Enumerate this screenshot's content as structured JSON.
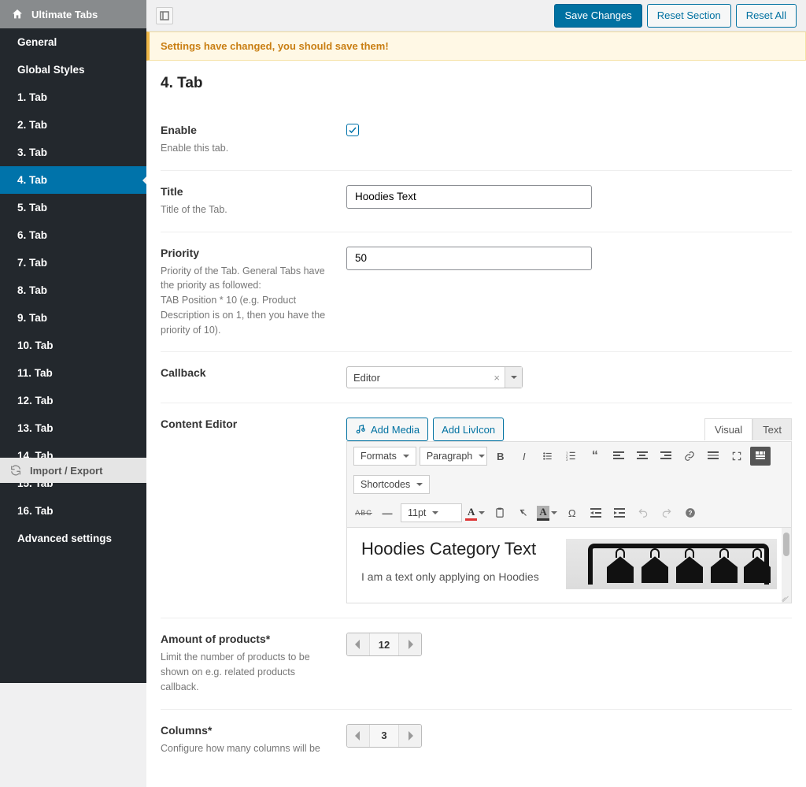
{
  "sidebar": {
    "title": "Ultimate Tabs",
    "items": [
      {
        "label": "General"
      },
      {
        "label": "Global Styles"
      },
      {
        "label": "1. Tab"
      },
      {
        "label": "2. Tab"
      },
      {
        "label": "3. Tab"
      },
      {
        "label": "4. Tab"
      },
      {
        "label": "5. Tab"
      },
      {
        "label": "6. Tab"
      },
      {
        "label": "7. Tab"
      },
      {
        "label": "8. Tab"
      },
      {
        "label": "9. Tab"
      },
      {
        "label": "10. Tab"
      },
      {
        "label": "11. Tab"
      },
      {
        "label": "12. Tab"
      },
      {
        "label": "13. Tab"
      },
      {
        "label": "14. Tab"
      },
      {
        "label": "15. Tab"
      },
      {
        "label": "16. Tab"
      },
      {
        "label": "Advanced settings"
      }
    ],
    "import_export": "Import / Export"
  },
  "topbar": {
    "save": "Save Changes",
    "reset_section": "Reset Section",
    "reset_all": "Reset All"
  },
  "notice": "Settings have changed, you should save them!",
  "page": {
    "title": "4. Tab"
  },
  "fields": {
    "enable": {
      "label": "Enable",
      "desc": "Enable this tab.",
      "checked": true
    },
    "title": {
      "label": "Title",
      "desc": "Title of the Tab.",
      "value": "Hoodies Text"
    },
    "priority": {
      "label": "Priority",
      "desc": "Priority of the Tab. General Tabs have the priority as followed:\nTAB Position * 10 (e.g. Product Description is on 1, then you have the priority of 10).",
      "value": "50"
    },
    "callback": {
      "label": "Callback",
      "value": "Editor",
      "clear": "×"
    },
    "content_editor": {
      "label": "Content Editor",
      "add_media": "Add Media",
      "add_livicon": "Add LivIcon",
      "tab_visual": "Visual",
      "tab_text": "Text",
      "formats": "Formats",
      "paragraph": "Paragraph",
      "shortcodes": "Shortcodes",
      "fontsize": "11pt",
      "body_heading": "Hoodies Category Text",
      "body_text": "I am a text only applying on Hoodies"
    },
    "amount": {
      "label": "Amount of products*",
      "desc": "Limit the number of products to be shown on e.g. related products callback.",
      "value": "12"
    },
    "columns": {
      "label": "Columns*",
      "desc": "Configure how many columns will be",
      "value": "3"
    }
  }
}
